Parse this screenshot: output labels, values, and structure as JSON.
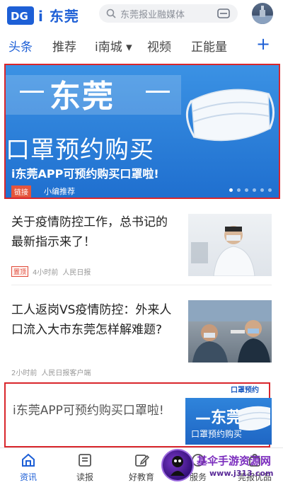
{
  "header": {
    "app_name": "i 东莞",
    "search_placeholder": "东莞报业融媒体"
  },
  "tabs": [
    {
      "label": "头条",
      "active": true
    },
    {
      "label": "推荐"
    },
    {
      "label": "i南城 ▾"
    },
    {
      "label": "视频"
    },
    {
      "label": "正能量"
    }
  ],
  "tab_add": "+",
  "banner": {
    "title": "东莞",
    "subtitle": "口罩预约购买",
    "caption": "i东莞APP可预约购买口罩啦!",
    "tag": "链接",
    "tag_label": "小编推荐",
    "slide_count": 6,
    "active_slide": 1
  },
  "news": [
    {
      "title": "关于疫情防控工作，总书记的最新指示来了！",
      "pin": "置顶",
      "time": "4小时前",
      "source": "人民日报"
    },
    {
      "title": "工人返岗VS疫情防控：外来人口流入大市东莞怎样解难题?",
      "time": "2小时前",
      "source": "人民日报客户端"
    }
  ],
  "ad": {
    "title": "i东莞APP可预约购买口罩啦!",
    "thumb_title": "—东莞—",
    "thumb_sub": "口罩预约购买",
    "sticker": "口罩预约"
  },
  "bottom_nav": [
    {
      "label": "资讯",
      "active": true,
      "icon": "home-icon"
    },
    {
      "label": "读报",
      "icon": "newspaper-icon"
    },
    {
      "label": "好教育",
      "icon": "edit-icon"
    },
    {
      "label": "服务",
      "icon": "service-icon"
    },
    {
      "label": "莞报优品",
      "icon": "shop-icon"
    }
  ],
  "watermark": {
    "text": "基伞手游资源网",
    "url": "www.j313.com"
  },
  "colors": {
    "brand": "#1d5fd6",
    "highlight_border": "#d9262c"
  }
}
